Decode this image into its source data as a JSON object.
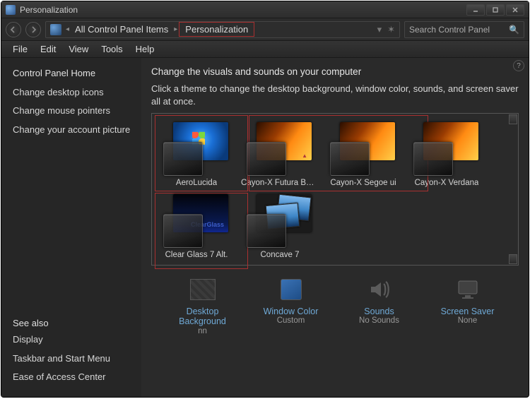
{
  "window": {
    "title": "Personalization"
  },
  "breadcrumb": {
    "root_icon": "control-panel-icon",
    "items": [
      "All Control Panel Items",
      "Personalization"
    ]
  },
  "search": {
    "placeholder": "Search Control Panel"
  },
  "menu": {
    "file": "File",
    "edit": "Edit",
    "view": "View",
    "tools": "Tools",
    "help": "Help"
  },
  "sidebar": {
    "home": "Control Panel Home",
    "links": [
      "Change desktop icons",
      "Change mouse pointers",
      "Change your account picture"
    ],
    "see_also": "See also",
    "see_links": [
      "Display",
      "Taskbar and Start Menu",
      "Ease of Access Center"
    ]
  },
  "main": {
    "heading": "Change the visuals and sounds on your computer",
    "desc": "Click a theme to change the desktop background, window color, sounds, and screen saver all at once."
  },
  "themes": [
    {
      "label": "AeroLucida",
      "wall": "win7"
    },
    {
      "label": "Cayon-X Futura BK BT",
      "wall": "orange",
      "logo": true
    },
    {
      "label": "Cayon-X Segoe ui",
      "wall": "orange"
    },
    {
      "label": "Cayon-X Verdana",
      "wall": "orange"
    },
    {
      "label": "Clear Glass 7 Alt.",
      "wall": "blackblue",
      "clearglass": true
    },
    {
      "label": "Concave 7",
      "wall": "concave"
    }
  ],
  "controls": {
    "desktop": {
      "label": "Desktop Background",
      "sub": "nn"
    },
    "color": {
      "label": "Window Color",
      "sub": "Custom"
    },
    "sounds": {
      "label": "Sounds",
      "sub": "No Sounds"
    },
    "saver": {
      "label": "Screen Saver",
      "sub": "None"
    }
  }
}
